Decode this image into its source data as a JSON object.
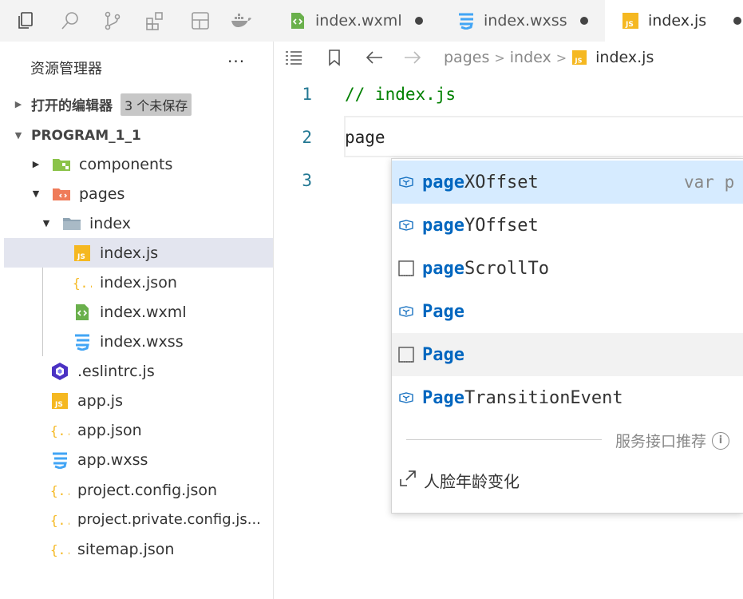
{
  "explorer": {
    "title": "资源管理器",
    "more_label": "···",
    "open_editors_label": "打开的编辑器",
    "unsaved_badge": "3 个未保存",
    "project_label": "PROGRAM_1_1"
  },
  "tree": [
    {
      "name": "components",
      "icon": "folder-components-icon"
    },
    {
      "name": "pages",
      "icon": "folder-pages-icon"
    },
    {
      "name": "index",
      "icon": "folder-icon"
    },
    {
      "name": "index.js",
      "icon": "js-file-icon"
    },
    {
      "name": "index.json",
      "icon": "json-file-icon"
    },
    {
      "name": "index.wxml",
      "icon": "wxml-file-icon"
    },
    {
      "name": "index.wxss",
      "icon": "css-file-icon"
    },
    {
      "name": ".eslintrc.js",
      "icon": "eslint-file-icon"
    },
    {
      "name": "app.js",
      "icon": "js-file-icon"
    },
    {
      "name": "app.json",
      "icon": "json-file-icon"
    },
    {
      "name": "app.wxss",
      "icon": "css-file-icon"
    },
    {
      "name": "project.config.json",
      "icon": "json-file-icon"
    },
    {
      "name": "project.private.config.js...",
      "icon": "json-file-icon"
    },
    {
      "name": "sitemap.json",
      "icon": "json-file-icon"
    }
  ],
  "tabs": [
    {
      "label": "index.wxml",
      "icon": "wxml-file-icon",
      "dirty": true
    },
    {
      "label": "index.wxss",
      "icon": "css-file-icon",
      "dirty": true
    },
    {
      "label": "index.js",
      "icon": "js-file-icon",
      "dirty": true
    }
  ],
  "breadcrumb": {
    "parts": [
      "pages",
      "index"
    ],
    "file": "index.js",
    "separator": ">"
  },
  "editor": {
    "lines": [
      {
        "number": "1",
        "text": "// index.js"
      },
      {
        "number": "2",
        "text": "page"
      },
      {
        "number": "3",
        "text": ""
      }
    ]
  },
  "suggest": {
    "items": [
      {
        "match": "page",
        "rest": "XOffset",
        "kind": "variable-icon",
        "detail": "var p"
      },
      {
        "match": "page",
        "rest": "YOffset",
        "kind": "variable-icon",
        "detail": ""
      },
      {
        "match": "page",
        "rest": "ScrollTo",
        "kind": "text-icon",
        "detail": ""
      },
      {
        "match": "Page",
        "rest": "",
        "kind": "variable-icon",
        "detail": ""
      },
      {
        "match": "Page",
        "rest": "",
        "kind": "text-icon",
        "detail": ""
      },
      {
        "match": "Page",
        "rest": "TransitionEvent",
        "kind": "variable-icon",
        "detail": ""
      }
    ],
    "section_label": "服务接口推荐",
    "service_label": "人脸年龄变化"
  },
  "colors": {
    "accent_blue": "#0066bf",
    "comment_green": "#008000",
    "line_number": "#237893",
    "focused_row": "#d6ebff",
    "selected_tree_row": "#e3e5ef"
  }
}
